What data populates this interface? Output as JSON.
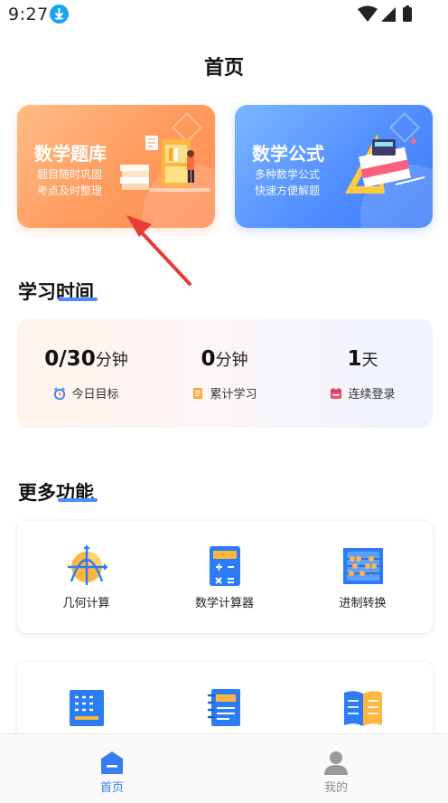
{
  "status_bar": {
    "time": "9:27"
  },
  "page": {
    "title": "首页"
  },
  "cards": [
    {
      "title": "数学题库",
      "line1": "题目随时巩固",
      "line2": "考点及时整理"
    },
    {
      "title": "数学公式",
      "line1": "多种数学公式",
      "line2": "快速方便解题"
    }
  ],
  "study_section": {
    "title": "学习时间",
    "stats": [
      {
        "value": "0/30",
        "unit": "分钟",
        "label": "今日目标",
        "icon": "alarm-clock-icon"
      },
      {
        "value": "0",
        "unit": "分钟",
        "label": "累计学习",
        "icon": "document-icon"
      },
      {
        "value": "1",
        "unit": "天",
        "label": "连续登录",
        "icon": "calendar-icon"
      }
    ]
  },
  "more_section": {
    "title": "更多功能",
    "features": [
      {
        "label": "几何计算",
        "icon": "geometry-graph-icon"
      },
      {
        "label": "数学计算器",
        "icon": "calculator-icon"
      },
      {
        "label": "进制转换",
        "icon": "abacus-icon"
      },
      {
        "label": "",
        "icon": "keypad-icon"
      },
      {
        "label": "",
        "icon": "notebook-icon"
      },
      {
        "label": "",
        "icon": "open-book-icon"
      }
    ]
  },
  "tab_bar": {
    "tabs": [
      {
        "label": "首页",
        "icon": "home-icon",
        "active": true
      },
      {
        "label": "我的",
        "icon": "user-icon",
        "active": false
      }
    ]
  },
  "colors": {
    "accent": "#3a7cf6",
    "orange_card": "#ff9a5d",
    "blue_card": "#4f8cff"
  }
}
